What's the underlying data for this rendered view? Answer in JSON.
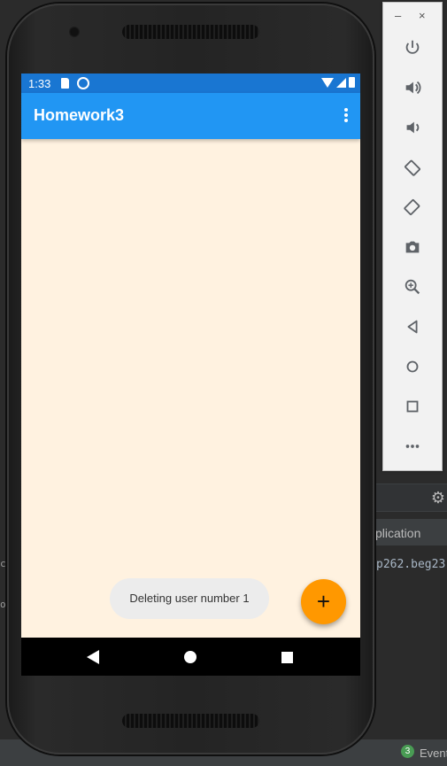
{
  "ide": {
    "tab_partial_label": "plication",
    "log_partial": "p262.beg23",
    "left_fragment_1": "c",
    "left_fragment_2": "o",
    "event_count": "3",
    "event_label": "Event"
  },
  "device": {
    "status_bar": {
      "time": "1:33"
    },
    "app_bar": {
      "title": "Homework3"
    },
    "toast": {
      "message": "Deleting user number 1"
    },
    "fab": {
      "symbol": "+"
    },
    "colors": {
      "status_bar": "#1976d2",
      "app_bar": "#2196f3",
      "content_background": "#fff2e0",
      "fab": "#ff9800"
    }
  },
  "emulator_toolbar": {
    "window_controls": {
      "minimize": "–",
      "close": "×"
    },
    "buttons": [
      {
        "name": "power-icon"
      },
      {
        "name": "volume-up-icon"
      },
      {
        "name": "volume-down-icon"
      },
      {
        "name": "rotate-left-icon"
      },
      {
        "name": "rotate-right-icon"
      },
      {
        "name": "camera-icon"
      },
      {
        "name": "zoom-icon"
      },
      {
        "name": "back-icon"
      },
      {
        "name": "home-icon"
      },
      {
        "name": "overview-icon"
      },
      {
        "name": "more-icon"
      }
    ]
  }
}
